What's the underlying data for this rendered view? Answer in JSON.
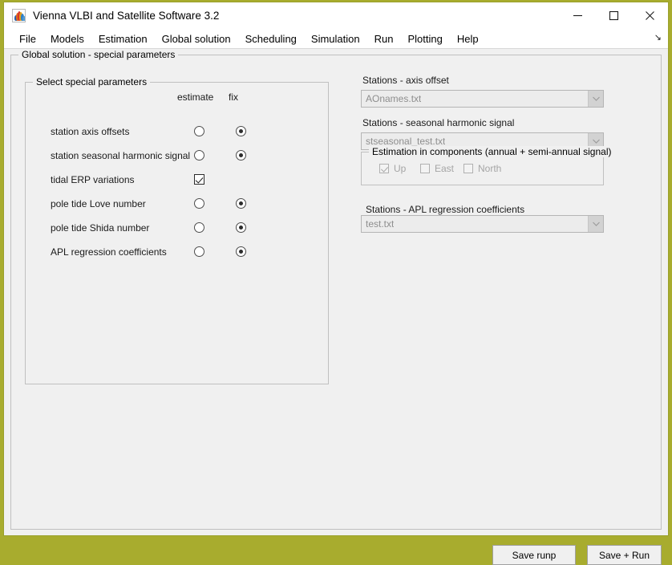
{
  "window": {
    "title": "Vienna VLBI and Satellite Software 3.2",
    "icon": "matlab-icon",
    "controls": {
      "minimize": "minimize-icon",
      "maximize": "maximize-icon",
      "close": "close-icon"
    },
    "border_color": "#a8ac2e"
  },
  "menubar": {
    "items": [
      {
        "label": "File"
      },
      {
        "label": "Models"
      },
      {
        "label": "Estimation"
      },
      {
        "label": "Global solution"
      },
      {
        "label": "Scheduling"
      },
      {
        "label": "Simulation"
      },
      {
        "label": "Run"
      },
      {
        "label": "Plotting"
      },
      {
        "label": "Help"
      }
    ],
    "overflow_glyph": "↘"
  },
  "outer_panel": {
    "title": "Global solution - special parameters"
  },
  "select_panel": {
    "title": "Select special parameters",
    "columns": {
      "estimate": "estimate",
      "fix": "fix"
    },
    "rows": [
      {
        "label": "station axis offsets",
        "control": "radio",
        "estimate": false,
        "fix": true
      },
      {
        "label": "station seasonal harmonic signal",
        "control": "radio",
        "estimate": false,
        "fix": true
      },
      {
        "label": "tidal ERP variations",
        "control": "checkbox",
        "estimate": true,
        "fix": null
      },
      {
        "label": "pole tide Love number",
        "control": "radio",
        "estimate": false,
        "fix": true
      },
      {
        "label": "pole tide Shida number",
        "control": "radio",
        "estimate": false,
        "fix": true
      },
      {
        "label": "APL regression coefficients",
        "control": "radio",
        "estimate": false,
        "fix": true
      }
    ]
  },
  "right_panel": {
    "axis_offset": {
      "label": "Stations - axis offset",
      "value": "AOnames.txt",
      "enabled": false
    },
    "seasonal": {
      "label": "Stations - seasonal harmonic signal",
      "value": "stseasonal_test.txt",
      "enabled": false
    },
    "components": {
      "title": "Estimation in components (annual + semi-annual signal)",
      "items": [
        {
          "label": "Up",
          "checked": true
        },
        {
          "label": "East",
          "checked": false
        },
        {
          "label": "North",
          "checked": false
        }
      ]
    },
    "apl": {
      "label": "Stations - APL regression coefficients",
      "value": "test.txt",
      "enabled": false
    }
  },
  "footer": {
    "save_runp": "Save runp",
    "save_run": "Save + Run"
  }
}
